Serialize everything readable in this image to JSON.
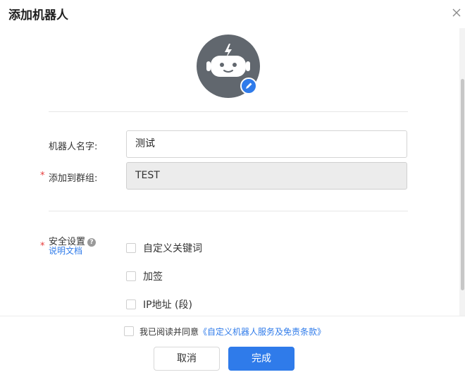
{
  "dialog": {
    "title": "添加机器人",
    "close_icon": "close-icon"
  },
  "avatar": {
    "icon": "robot-avatar-icon",
    "edit_icon": "pencil-icon",
    "accent_color": "#2f7bea"
  },
  "form": {
    "name_label": "机器人名字:",
    "name_value": "测试",
    "group_label": "添加到群组:",
    "group_value": "TEST",
    "required_mark": "*",
    "security_label": "安全设置",
    "security_help_icon": "?",
    "doc_link": "说明文档",
    "security_options": [
      {
        "label": "自定义关键词",
        "checked": false
      },
      {
        "label": "加签",
        "checked": false
      },
      {
        "label": "IP地址 (段)",
        "checked": false
      }
    ]
  },
  "footer": {
    "agree_prefix": "我已阅读并同意",
    "agree_terms": "《自定义机器人服务及免责条款》",
    "agree_checked": false,
    "cancel_label": "取消",
    "done_label": "完成"
  }
}
